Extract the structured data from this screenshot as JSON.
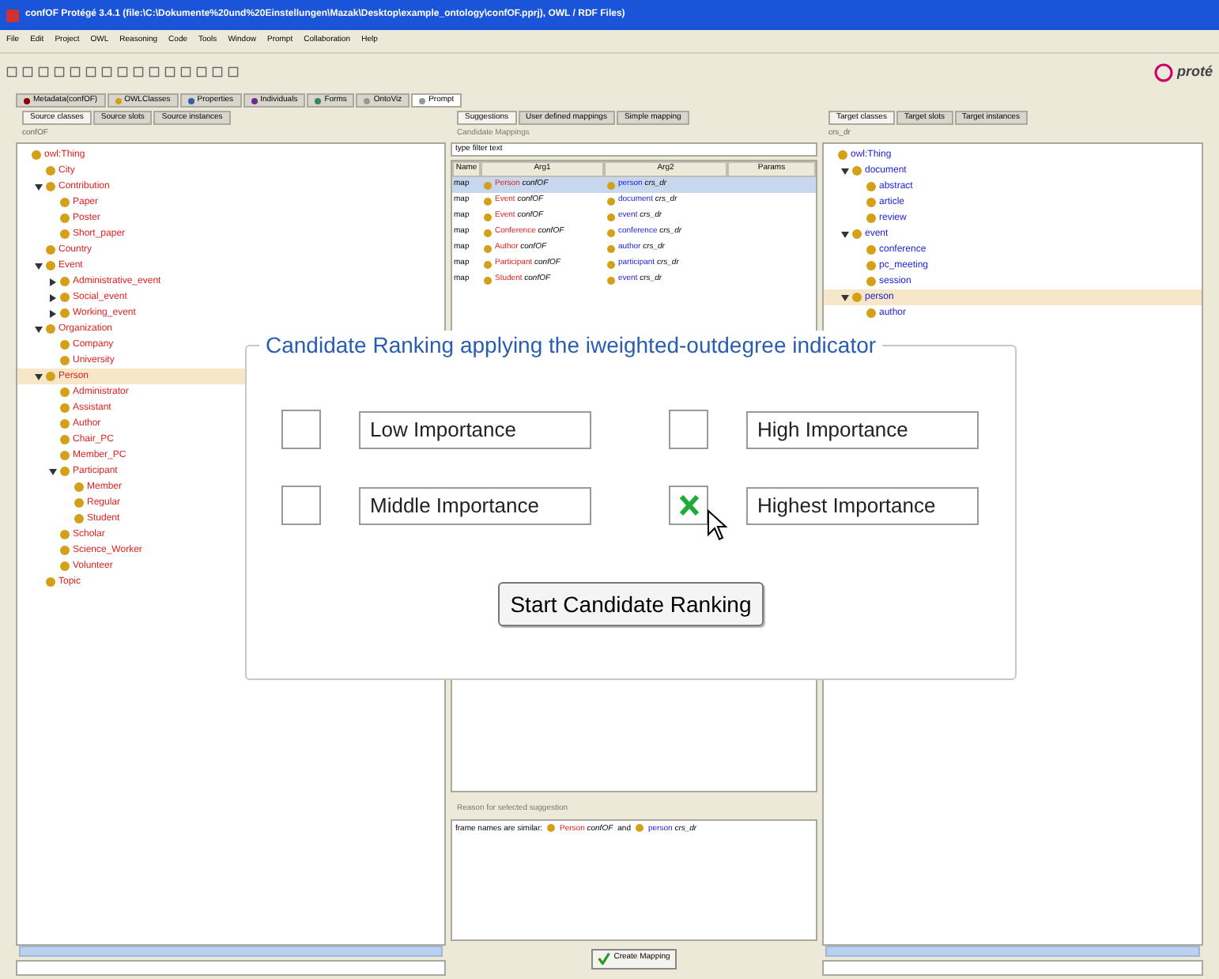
{
  "window": {
    "title": "confOF  Protégé 3.4.1    (file:\\C:\\Dokumente%20und%20Einstellungen\\Mazak\\Desktop\\example_ontology\\confOF.pprj), OWL / RDF Files)"
  },
  "menu": [
    "File",
    "Edit",
    "Project",
    "OWL",
    "Reasoning",
    "Code",
    "Tools",
    "Window",
    "Prompt",
    "Collaboration",
    "Help"
  ],
  "logo": {
    "text": "proté"
  },
  "tabs": [
    {
      "label": "Metadata(confOF)",
      "selected": false,
      "color": "#8b0000"
    },
    {
      "label": "OWLClasses",
      "selected": false,
      "color": "#d4a017"
    },
    {
      "label": "Properties",
      "selected": false,
      "color": "#2f5fa8"
    },
    {
      "label": "Individuals",
      "selected": false,
      "color": "#6a2c8c"
    },
    {
      "label": "Forms",
      "selected": false,
      "color": "#2e8b57"
    },
    {
      "label": "OntoViz",
      "selected": false,
      "color": "#999999"
    },
    {
      "label": "Prompt",
      "selected": true,
      "color": "#999999"
    }
  ],
  "source": {
    "tabs": [
      {
        "label": "Source classes",
        "selected": true
      },
      {
        "label": "Source slots",
        "selected": false
      },
      {
        "label": "Source instances",
        "selected": false
      }
    ],
    "header": "confOF",
    "tree": [
      {
        "label": "owl:Thing",
        "selected": false,
        "children": [
          {
            "label": "City",
            "selected": false
          },
          {
            "label": "Contribution",
            "selected": false,
            "expanded": true,
            "children": [
              {
                "label": "Paper",
                "selected": false
              },
              {
                "label": "Poster",
                "selected": false
              },
              {
                "label": "Short_paper",
                "selected": false
              }
            ]
          },
          {
            "label": "Country",
            "selected": false
          },
          {
            "label": "Event",
            "selected": false,
            "expanded": true,
            "children": [
              {
                "label": "Administrative_event",
                "selected": false,
                "expanded": false
              },
              {
                "label": "Social_event",
                "selected": false,
                "expanded": false
              },
              {
                "label": "Working_event",
                "selected": false,
                "expanded": false
              }
            ]
          },
          {
            "label": "Organization",
            "selected": false,
            "expanded": true,
            "children": [
              {
                "label": "Company",
                "selected": false
              },
              {
                "label": "University",
                "selected": false
              }
            ]
          },
          {
            "label": "Person",
            "selected": true,
            "expanded": true,
            "children": [
              {
                "label": "Administrator",
                "selected": false
              },
              {
                "label": "Assistant",
                "selected": false
              },
              {
                "label": "Author",
                "selected": false
              },
              {
                "label": "Chair_PC",
                "selected": false
              },
              {
                "label": "Member_PC",
                "selected": false
              },
              {
                "label": "Participant",
                "selected": false,
                "expanded": true,
                "children": [
                  {
                    "label": "Member",
                    "selected": false
                  },
                  {
                    "label": "Regular",
                    "selected": false
                  },
                  {
                    "label": "Student",
                    "selected": false
                  }
                ]
              },
              {
                "label": "Scholar",
                "selected": false
              },
              {
                "label": "Science_Worker",
                "selected": false
              },
              {
                "label": "Volunteer",
                "selected": false
              }
            ]
          },
          {
            "label": "Topic",
            "selected": false
          }
        ]
      }
    ]
  },
  "suggestions": {
    "tabs": [
      {
        "label": "Suggestions",
        "selected": true
      },
      {
        "label": "User defined mappings",
        "selected": false
      },
      {
        "label": "Simple mapping",
        "selected": false
      }
    ],
    "header": "Candidate Mappings",
    "filter": {
      "value": "type filter text"
    },
    "columns": [
      "Name",
      "Arg1",
      "Arg2",
      "Params"
    ],
    "rows": [
      {
        "name": "map",
        "arg1": "Person",
        "arg1_onto": "confOF",
        "arg2": "person",
        "arg2_onto": "crs_dr",
        "selected": true
      },
      {
        "name": "map",
        "arg1": "Event",
        "arg1_onto": "confOF",
        "arg2": "document",
        "arg2_onto": "crs_dr",
        "selected": false
      },
      {
        "name": "map",
        "arg1": "Event",
        "arg1_onto": "confOF",
        "arg2": "event",
        "arg2_onto": "crs_dr",
        "selected": false
      },
      {
        "name": "map",
        "arg1": "Conference",
        "arg1_onto": "confOF",
        "arg2": "conference",
        "arg2_onto": "crs_dr",
        "selected": false
      },
      {
        "name": "map",
        "arg1": "Author",
        "arg1_onto": "confOF",
        "arg2": "author",
        "arg2_onto": "crs_dr",
        "selected": false
      },
      {
        "name": "map",
        "arg1": "Participant",
        "arg1_onto": "confOF",
        "arg2": "participant",
        "arg2_onto": "crs_dr",
        "selected": false
      },
      {
        "name": "map",
        "arg1": "Student",
        "arg1_onto": "confOF",
        "arg2": "event",
        "arg2_onto": "crs_dr",
        "selected": false
      }
    ],
    "reason": {
      "header": "Reason for selected suggestion",
      "text": "frame names are similar:",
      "arg1": "Person",
      "arg1_onto": "confOF",
      "joiner": "and",
      "arg2": "person",
      "arg2_onto": "crs_dr"
    },
    "button": "Create Mapping"
  },
  "target": {
    "tabs": [
      {
        "label": "Target classes",
        "selected": true
      },
      {
        "label": "Target slots",
        "selected": false
      },
      {
        "label": "Target instances",
        "selected": false
      }
    ],
    "header": "crs_dr",
    "tree": [
      {
        "label": "owl:Thing",
        "selected": false,
        "children": [
          {
            "label": "document",
            "selected": false,
            "expanded": true,
            "children": [
              {
                "label": "abstract",
                "selected": false
              },
              {
                "label": "article",
                "selected": false
              },
              {
                "label": "review",
                "selected": false
              }
            ]
          },
          {
            "label": "event",
            "selected": false,
            "expanded": true,
            "children": [
              {
                "label": "conference",
                "selected": false
              },
              {
                "label": "pc_meeting",
                "selected": false
              },
              {
                "label": "session",
                "selected": false
              }
            ]
          },
          {
            "label": "person",
            "selected": true,
            "expanded": true,
            "children": [
              {
                "label": "author",
                "selected": false
              }
            ]
          }
        ]
      }
    ]
  },
  "dialog": {
    "title": "Candidate Ranking applying the iweighted-outdegree indicator",
    "options": [
      {
        "label": "Low Importance",
        "checked": false
      },
      {
        "label": "High Importance",
        "checked": false
      },
      {
        "label": "Middle Importance",
        "checked": false
      },
      {
        "label": "Highest Importance",
        "checked": true
      }
    ],
    "button": "Start Candidate Ranking"
  }
}
